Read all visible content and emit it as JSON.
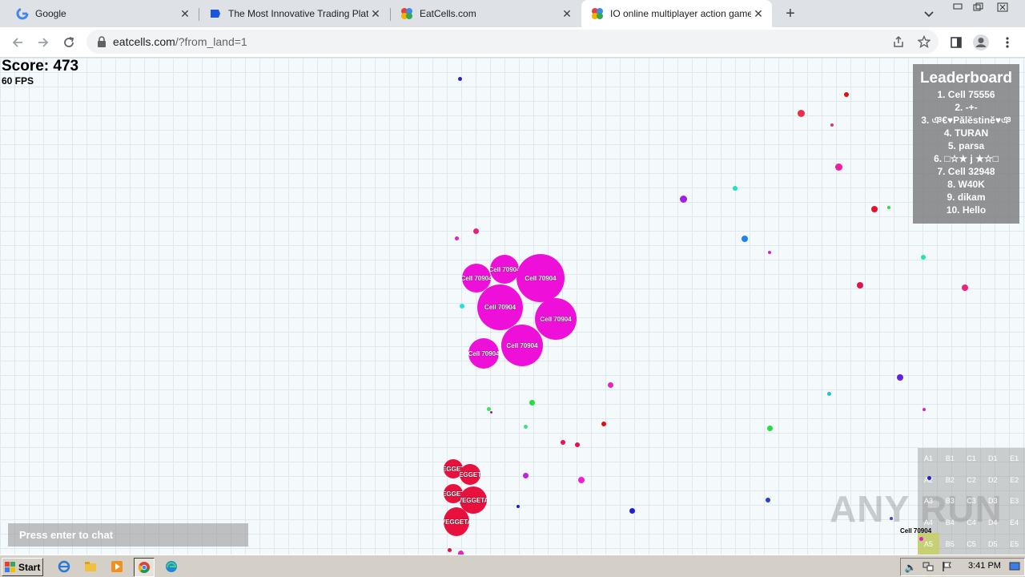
{
  "browser": {
    "tabs": [
      {
        "title": "Google",
        "icon": "google-icon",
        "active": false
      },
      {
        "title": "The Most Innovative Trading Platform",
        "icon": "trading-platform-icon",
        "active": false
      },
      {
        "title": "EatCells.com",
        "icon": "eatcells-icon",
        "active": false
      },
      {
        "title": "IO online multiplayer action game. S",
        "icon": "eatcells-icon",
        "active": true
      }
    ],
    "new_tab_label": "+",
    "url_host": "eatcells.com",
    "url_path": "/?from_land=1"
  },
  "game": {
    "score_label": "Score: 473",
    "fps_label": "60 FPS",
    "player_name": "Cell 70904",
    "enemy_name": "VEGGETA",
    "leaderboard": {
      "title": "Leaderboard",
      "entries": [
        "1. Cell 75556",
        "2. -+-",
        "3. ঞ€♥Pălĕstinĕ♥ঞ",
        "4. TURAN",
        "5. parsa",
        "6. □☆★ j ★☆□",
        "7. Cell 32948",
        "8. W40K",
        "9. dikam",
        "10. Hello"
      ]
    },
    "minimap": {
      "rows": [
        [
          "A1",
          "B1",
          "C1",
          "D1",
          "E1"
        ],
        [
          "A2",
          "B2",
          "C2",
          "D2",
          "E2"
        ],
        [
          "A3",
          "B3",
          "C3",
          "D3",
          "E3"
        ],
        [
          "A4",
          "B4",
          "C4",
          "D4",
          "E4"
        ],
        [
          "A5",
          "B5",
          "C5",
          "D5",
          "E5"
        ]
      ],
      "current_sector": "A5",
      "player_label": "Cell 70904"
    },
    "chat_placeholder": "Press enter to chat",
    "watermark": "ANY RUN"
  },
  "taskbar": {
    "start_label": "Start",
    "clock": "3:41 PM"
  },
  "colors": {
    "player_cell": "#ee10d8",
    "enemy_cell": "#e8103c",
    "tab_strip": "#dee1e6",
    "taskbar": "#d4d0c8"
  }
}
